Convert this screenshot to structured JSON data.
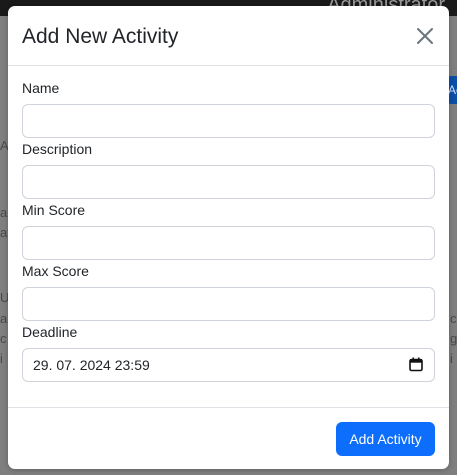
{
  "background": {
    "admin_text": "Administrator",
    "button_text": "Ac",
    "fragments_left": [
      "A",
      "ar",
      "at",
      "U",
      "a",
      "c",
      "i"
    ],
    "fragments_right": [
      "c",
      "g",
      "i"
    ]
  },
  "modal": {
    "title": "Add New Activity",
    "close_icon": "close-icon",
    "fields": {
      "name": {
        "label": "Name",
        "value": ""
      },
      "description": {
        "label": "Description",
        "value": ""
      },
      "min_score": {
        "label": "Min Score",
        "value": ""
      },
      "max_score": {
        "label": "Max Score",
        "value": ""
      },
      "deadline": {
        "label": "Deadline",
        "value": "29. 07. 2024 23:59",
        "icon": "calendar-icon"
      }
    },
    "submit_label": "Add Activity"
  },
  "colors": {
    "primary": "#0d6efd",
    "overlay": "#7f7f7f",
    "border": "#ced4da"
  }
}
